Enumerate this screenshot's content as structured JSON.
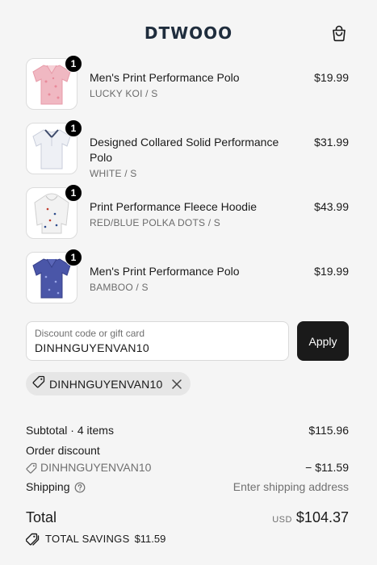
{
  "header": {
    "logo": "DTWOOO",
    "cart_icon": "shopping-bag-icon"
  },
  "items": [
    {
      "name": "Men's Print Performance Polo",
      "variant": "LUCKY KOI / S",
      "price": "$19.99",
      "quantity": "1"
    },
    {
      "name": "Designed Collared Solid Performance Polo",
      "variant": "WHITE / S",
      "price": "$31.99",
      "quantity": "1"
    },
    {
      "name": "Print Performance Fleece Hoodie",
      "variant": "RED/BLUE POLKA DOTS / S",
      "price": "$43.99",
      "quantity": "1"
    },
    {
      "name": "Men's Print Performance Polo",
      "variant": "BAMBOO / S",
      "price": "$19.99",
      "quantity": "1"
    }
  ],
  "discount": {
    "label": "Discount code or gift card",
    "value": "DINHNGUYENVAN10",
    "apply_label": "Apply"
  },
  "applied_code": "DINHNGUYENVAN10",
  "summary": {
    "subtotal_label": "Subtotal · 4 items",
    "subtotal_value": "$115.96",
    "order_discount_label": "Order discount",
    "discount_code": "DINHNGUYENVAN10",
    "discount_value": "− $11.59",
    "shipping_label": "Shipping",
    "shipping_value": "Enter shipping address",
    "total_label": "Total",
    "currency": "USD",
    "total_value": "$104.37",
    "savings_label": "TOTAL SAVINGS",
    "savings_value": "$11.59"
  },
  "colors": {
    "background": "#f5f5f5",
    "button": "#1a1a1a",
    "logo": "#1f2d3d"
  }
}
